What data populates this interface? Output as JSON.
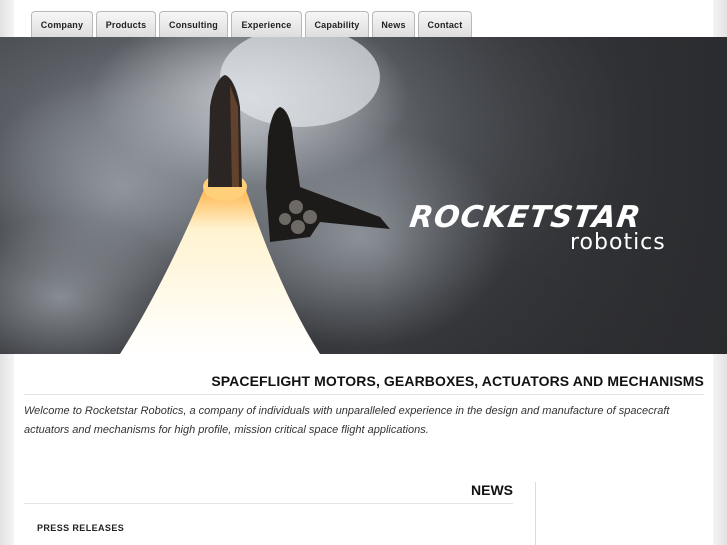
{
  "nav": {
    "tabs": [
      {
        "label": "Company"
      },
      {
        "label": "Products"
      },
      {
        "label": "Consulting"
      },
      {
        "label": "Experience"
      },
      {
        "label": "Capability"
      },
      {
        "label": "News"
      },
      {
        "label": "Contact"
      }
    ]
  },
  "hero": {
    "logo_main": "ROCKETSTAR",
    "logo_sub": "robotics"
  },
  "content": {
    "tagline": "SPACEFLIGHT MOTORS, GEARBOXES, ACTUATORS AND MECHANISMS",
    "intro": "Welcome to Rocketstar Robotics, a company of individuals with unparalleled experience in the design and manufacture of spacecraft actuators and mechanisms for high profile, mission critical space flight applications."
  },
  "news": {
    "title": "NEWS",
    "press_releases": "PRESS RELEASES"
  }
}
